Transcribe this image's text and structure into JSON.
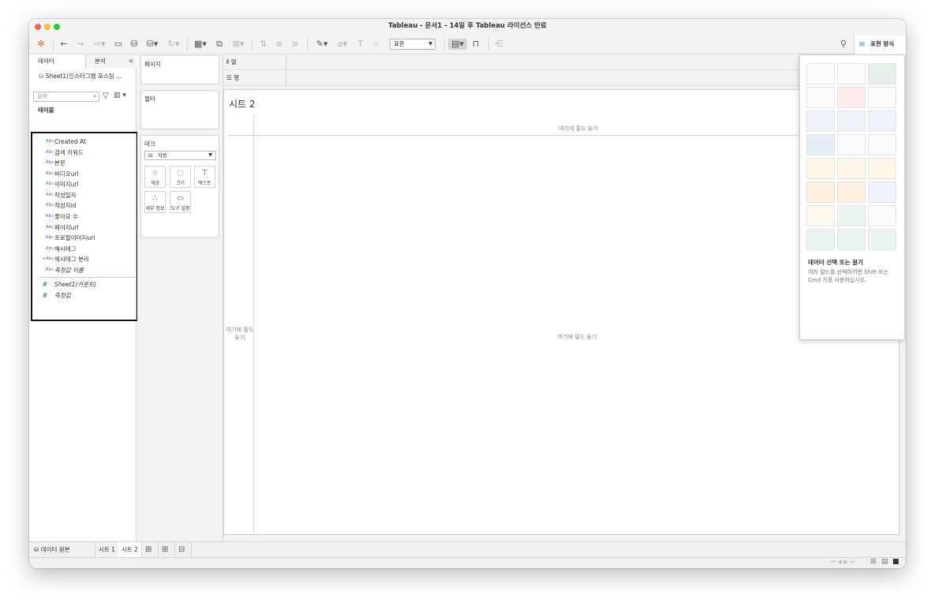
{
  "window": {
    "title": "Tableau - 문서1 - 14일 후 Tableau 라이선스 만료"
  },
  "toolbar": {
    "mark_size_value": "표준",
    "show_me_label": "표현 방식"
  },
  "data_pane": {
    "tabs": [
      "데이터",
      "분석"
    ],
    "collapse_glyph": "<",
    "datasource": "Sheet1(인스타그램 포스팅 ...",
    "search_placeholder": "검색",
    "section_title": "테이블",
    "fields": [
      {
        "type": "Abc",
        "name": "Created At",
        "italic": false
      },
      {
        "type": "Abc",
        "name": "검색 키워드",
        "italic": false
      },
      {
        "type": "Abc",
        "name": "본문",
        "italic": false
      },
      {
        "type": "Abc",
        "name": "비디오url",
        "italic": false
      },
      {
        "type": "Abc",
        "name": "이미지url",
        "italic": false
      },
      {
        "type": "Abc",
        "name": "작성일자",
        "italic": false
      },
      {
        "type": "Abc",
        "name": "작성자id",
        "italic": false
      },
      {
        "type": "Abc",
        "name": "좋아요 수",
        "italic": false
      },
      {
        "type": "Abc",
        "name": "페이지url",
        "italic": false
      },
      {
        "type": "Abc",
        "name": "프로필이미지url",
        "italic": false
      },
      {
        "type": "Abc",
        "name": "해시태그",
        "italic": false
      },
      {
        "type": "+Abc",
        "name": "해시태그 분리",
        "italic": false
      },
      {
        "type": "Abc",
        "name": "측정값 이름",
        "italic": true
      }
    ],
    "measures": [
      {
        "type": "#",
        "name": "Sheet1(카운트)",
        "italic": true
      },
      {
        "type": "#",
        "name": "측정값",
        "italic": true
      }
    ]
  },
  "cards": {
    "pages_title": "페이지",
    "filters_title": "필터",
    "marks_title": "마크",
    "mark_type": "자동",
    "mark_buttons": [
      "색상",
      "크기",
      "텍스트",
      "세부 정보",
      "도구 설명"
    ]
  },
  "shelves": {
    "columns": "열",
    "rows": "행"
  },
  "sheet": {
    "title": "시트 2",
    "drop_header": "여기에 필드 놓기",
    "drop_center": "여기에 필드 놓기",
    "drop_rows": "여기에 필드 놓기"
  },
  "show_me": {
    "title": "데이터 선택 또는 끌기",
    "description": "여러 필드를 선택하려면 Shift 또는 Cmd 키를 사용하십시오."
  },
  "statusbar": {
    "datasource_tab": "데이터 원본",
    "sheet_tabs": [
      "시트 1",
      "시트 2"
    ],
    "active_sheet": "시트 2"
  }
}
